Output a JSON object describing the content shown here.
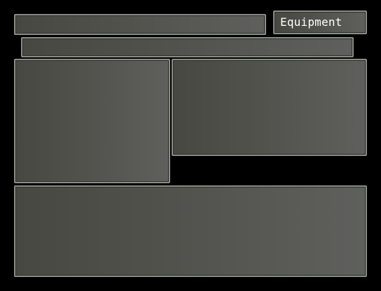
{
  "scene": {
    "title": "Equipment"
  },
  "colors": {
    "background": "#000000",
    "window_border": "#8a8c86",
    "window_fill_dark": "#474841",
    "window_fill_light": "#5f605d",
    "text": "#ffffff"
  }
}
